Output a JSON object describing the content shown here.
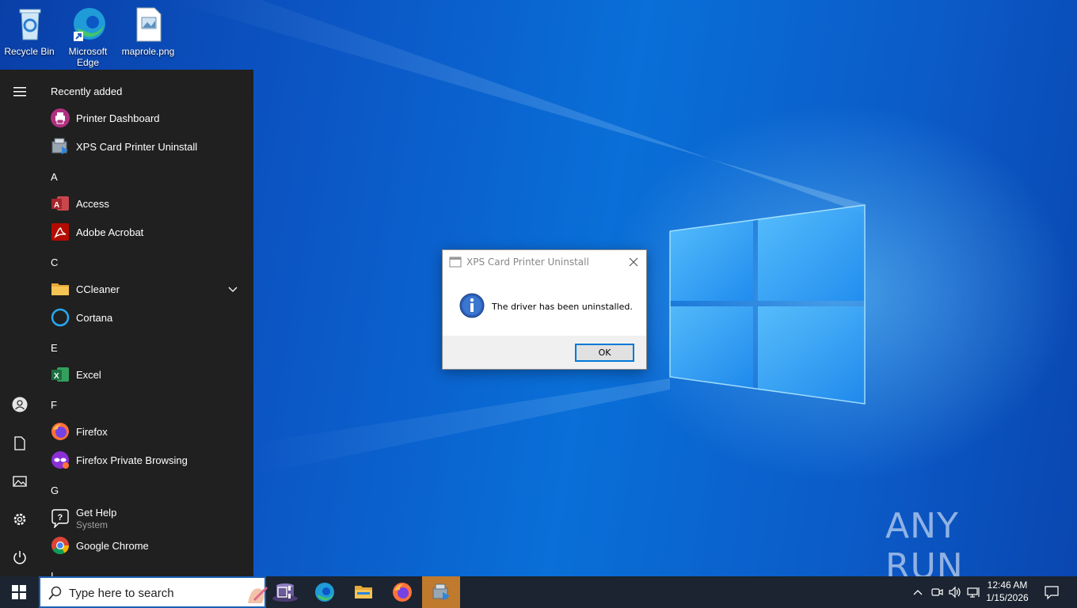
{
  "desktop": {
    "icons": [
      {
        "label": "Recycle Bin",
        "icon": "recycle-bin-icon"
      },
      {
        "label": "Microsoft Edge",
        "icon": "edge-icon"
      },
      {
        "label": "maprole.png",
        "icon": "image-file-icon"
      }
    ]
  },
  "start_menu": {
    "recently_added_label": "Recently added",
    "recent": [
      {
        "label": "Printer Dashboard",
        "icon": "printer-dashboard-icon"
      },
      {
        "label": "XPS Card Printer Uninstall",
        "icon": "uninstall-icon"
      }
    ],
    "sections": [
      {
        "letter": "A",
        "apps": [
          {
            "label": "Access",
            "icon": "access-icon"
          },
          {
            "label": "Adobe Acrobat",
            "icon": "acrobat-icon"
          }
        ]
      },
      {
        "letter": "C",
        "apps": [
          {
            "label": "CCleaner",
            "icon": "folder-icon",
            "expandable": true
          },
          {
            "label": "Cortana",
            "icon": "cortana-icon"
          }
        ]
      },
      {
        "letter": "E",
        "apps": [
          {
            "label": "Excel",
            "icon": "excel-icon"
          }
        ]
      },
      {
        "letter": "F",
        "apps": [
          {
            "label": "Firefox",
            "icon": "firefox-icon"
          },
          {
            "label": "Firefox Private Browsing",
            "icon": "firefox-private-icon"
          }
        ]
      },
      {
        "letter": "G",
        "apps": [
          {
            "label": "Get Help",
            "sublabel": "System",
            "icon": "get-help-icon"
          },
          {
            "label": "Google Chrome",
            "icon": "chrome-icon"
          }
        ]
      }
    ],
    "next_letter": "I",
    "rail": [
      "hamburger-icon",
      "user-icon",
      "documents-icon",
      "pictures-icon",
      "settings-icon",
      "power-icon"
    ]
  },
  "dialog": {
    "title": "XPS Card Printer Uninstall",
    "message": "The driver has been uninstalled.",
    "ok_label": "OK"
  },
  "watermark": {
    "text": "ANY RUN"
  },
  "taskbar": {
    "search_placeholder": "Type here to search",
    "pinned": [
      "task-view-icon",
      "edge-icon",
      "file-explorer-icon",
      "firefox-icon",
      "xps-uninstall-icon"
    ],
    "clock_time": "12:46 AM",
    "clock_date": "1/15/2026"
  },
  "colors": {
    "start_bg": "#202020",
    "taskbar_bg": "#1b2430",
    "active_app": "#c07a2e",
    "accent": "#0078d7"
  }
}
